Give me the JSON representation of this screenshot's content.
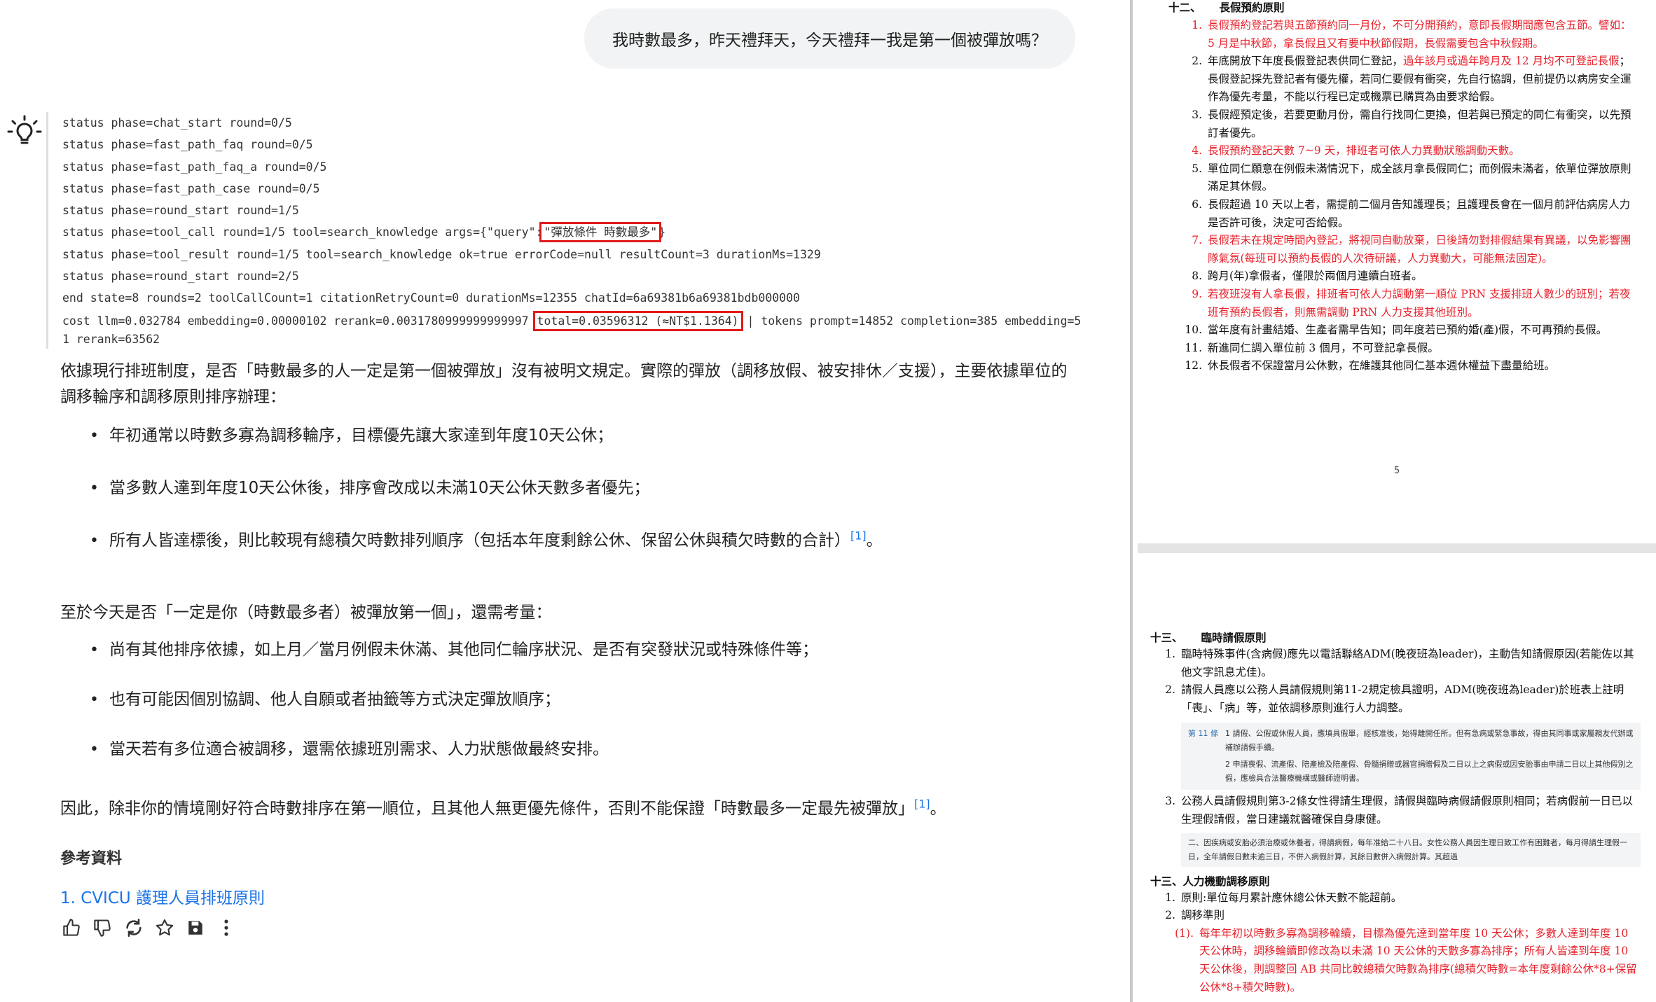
{
  "user_message": "我時數最多，昨天禮拜天，今天禮拜一我是第一個被彈放嗎？",
  "log": {
    "lines": [
      "status phase=chat_start round=0/5",
      "status phase=fast_path_faq round=0/5",
      "status phase=fast_path_faq_a round=0/5",
      "status phase=fast_path_case round=0/5",
      "status phase=round_start round=1/5"
    ],
    "tool_call_prefix": "status phase=tool_call round=1/5 tool=search_knowledge args={\"query\":",
    "tool_call_query": "\"彈放條件 時數最多\"",
    "tool_call_suffix": "}",
    "lines2": [
      "status phase=tool_result round=1/5 tool=search_knowledge ok=true errorCode=null resultCount=3 durationMs=1329",
      "status phase=round_start round=2/5",
      "end state=8 rounds=2 toolCallCount=1 citationRetryCount=0 durationMs=12355 chatId=6a69381b6a69381bdb000000"
    ],
    "cost_prefix": "cost llm=0.032784 embedding=0.00000102 rerank=0.0031780999999999997 ",
    "cost_total": "total=0.03596312 (≈NT$1.1364)",
    "cost_suffix": " | tokens prompt=14852 completion=385 embedding=51 rerank=63562"
  },
  "answer": {
    "intro": "依據現行排班制度，是否「時數最多的人一定是第一個被彈放」沒有被明文規定。實際的彈放（調移放假、被安排休／支援），主要依據單位的調移輪序和調移原則排序辦理：",
    "bullets1": [
      "年初通常以時數多寡為調移輪序，目標優先讓大家達到年度10天公休；",
      "當多數人達到年度10天公休後，排序會改成以未滿10天公休天數多者優先；",
      "所有人皆達標後，則比較現有總積欠時數排列順序（包括本年度剩餘公休、保留公休與積欠時數的合計）"
    ],
    "cite_label": "[1]",
    "para2": "至於今天是否「一定是你（時數最多者）被彈放第一個」，還需考量：",
    "bullets2": [
      "尚有其他排序依據，如上月／當月例假未休滿、其他同仁輪序狀況、是否有突發狀況或特殊條件等；",
      "也有可能因個別協調、他人自願或者抽籤等方式決定彈放順序；",
      "當天若有多位適合被調移，還需依據班別需求、人力狀態做最終安排。"
    ],
    "conclusion": "因此，除非你的情境剛好符合時數排序在第一順位，且其他人無更優先條件，否則不能保證「時數最多一定最先被彈放」",
    "refs_title": "參考資料",
    "ref1": "1. CVICU 護理人員排班原則"
  },
  "actions": [
    "thumb-up-icon",
    "thumb-down-icon",
    "refresh-icon",
    "star-icon",
    "save-icon",
    "more-vertical-icon"
  ],
  "doc_page1": {
    "heading_num": "十二、",
    "heading": "長假預約原則",
    "items": [
      {
        "n": "1.",
        "red": true,
        "text": "長假預約登記若與五節預約同一月份，不可分開預約，意即長假期間應包含五節。譬如：5 月是中秋節，拿長假且又有要中秋節假期，長假需要包含中秋假期。"
      },
      {
        "n": "2.",
        "red": false,
        "text": "年底開放下年度長假登記表供同仁登記，",
        "red_tail": "過年該月或過年跨月及 12 月均不可登記長假",
        "text_tail": "；長假登記採先登記者有優先權，若同仁要假有衝突，先自行協調，但前提仍以病房安全運作為優先考量，不能以行程已定或機票已購買為由要求給假。"
      },
      {
        "n": "3.",
        "red": false,
        "text": "長假經預定後，若要更動月份，需自行找同仁更換，但若與已預定的同仁有衝突，以先預訂者優先。"
      },
      {
        "n": "4.",
        "red": true,
        "text": "長假預約登記天數 7~9 天，排班者可依人力異動狀態調動天數。"
      },
      {
        "n": "5.",
        "red": false,
        "text": "單位同仁願意在例假未滿情況下，成全該月拿長假同仁；而例假未滿者，依單位彈放原則滿足其休假。"
      },
      {
        "n": "6.",
        "red": false,
        "text": "長假超過 10 天以上者，需提前二個月告知護理長；且護理長會在一個月前評估病房人力是否許可後，決定可否給假。"
      },
      {
        "n": "7.",
        "red": true,
        "text": "長假若未在規定時間內登記，將視同自動放棄，日後請勿對排假結果有異議，以免影響團隊氣氛(每班可以預約長假的人次待研議，人力異動大，可能無法固定)。"
      },
      {
        "n": "8.",
        "red": false,
        "text": "跨月(年)拿假者，僅限於兩個月連續白班者。"
      },
      {
        "n": "9.",
        "red": true,
        "text": "若夜班沒有人拿長假，排班者可依人力調動第一順位 PRN 支援排班人數少的班別；若夜班有預約長假者，則無需調動 PRN 人力支援其他班別。"
      },
      {
        "n": "10.",
        "red": false,
        "text": "當年度有計畫結婚、生產者需早告知；同年度若已預約婚(產)假，不可再預約長假。"
      },
      {
        "n": "11.",
        "red": false,
        "text": "新進同仁調入單位前 3 個月，不可登記拿長假。"
      },
      {
        "n": "12.",
        "red": false,
        "text": "休長假者不保證當月公休數，在維護其他同仁基本週休權益下盡量給班。"
      }
    ],
    "page_number": "5"
  },
  "doc_page2": {
    "heading_num": "十三、",
    "heading": "臨時請假原則",
    "items": [
      {
        "n": "1.",
        "text": "臨時特殊事件(含病假)應先以電話聯絡ADM(晚夜班為leader)，主動告知請假原因(若能佐以其他文字訊息尤佳)。"
      },
      {
        "n": "2.",
        "text": "請假人員應以公務人員請假規則第11-2規定檢具證明，ADM(晚夜班為leader)於班表上註明「喪」、「病」等，並依調移原則進行人力調整。"
      }
    ],
    "law_label": "第 11 條",
    "law1": "1 請假、公假或休假人員，應填具假單，經核准後，始得離開任所。但有急病或緊急事故，得由其同事或家屬親友代辦或補辦請假手續。",
    "law2": "2 申請喪假、流產假、陪產檢及陪產假、骨髓捐贈或器官捐贈假及二日以上之病假或因安胎事由申請二日以上其他假別之假，應檢具合法醫療機構或醫師證明書。",
    "item3_n": "3.",
    "item3": "公務人員請假規則第3-2條女性得請生理假，請假與臨時病假請假原則相同；若病假前一日已以生理假請假，當日建議就醫確保自身康健。",
    "law3": "二、因疾病或安胎必須治療或休養者，得請病假，每年准給二十八日。女性公務人員因生理日致工作有困難者，每月得請生理假一日，全年請假日數未逾三日，不併入病假計算，其餘日數併入病假計算。其超過",
    "heading2": "十三、人力機動調移原則",
    "items2": [
      {
        "n": "1.",
        "text": "原則:單位每月累計應休總公休天數不能超前。"
      },
      {
        "n": "2.",
        "text": "調移準則"
      }
    ],
    "sub_n": "(1).",
    "sub": "每年年初以時數多寡為調移輪續，目標為優先達到當年度 10 天公休；多數人達到年度 10 天公休時，調移輪續即修改為以未滿 10 天公休的天數多寡為排序；所有人皆達到年度 10 天公休後，則調整回 AB 共同比較總積欠時數為排序(總積欠時數=本年度剩餘公休*8+保留公休*8+積欠時數)。"
  }
}
